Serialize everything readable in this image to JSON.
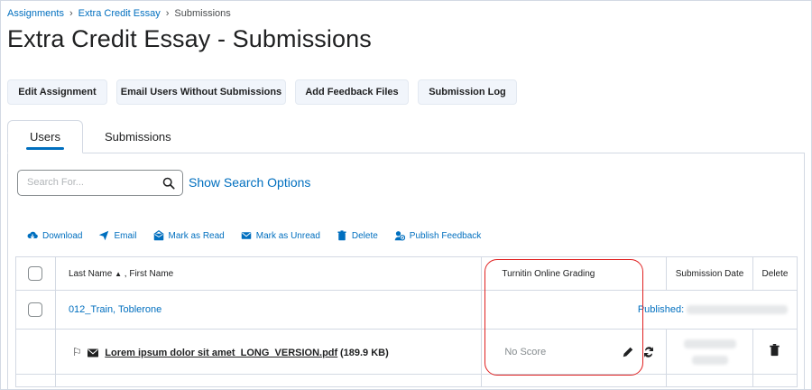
{
  "breadcrumbs": {
    "level1": "Assignments",
    "level2": "Extra Credit Essay",
    "current": "Submissions"
  },
  "page_title": "Extra Credit Essay - Submissions",
  "buttons": {
    "edit_assignment": "Edit Assignment",
    "email_users": "Email Users Without Submissions",
    "add_feedback": "Add Feedback Files",
    "submission_log": "Submission Log"
  },
  "tabs": {
    "users": "Users",
    "submissions": "Submissions"
  },
  "search": {
    "placeholder": "Search For...",
    "options_link": "Show Search Options"
  },
  "actions": {
    "download": "Download",
    "email": "Email",
    "mark_read": "Mark as Read",
    "mark_unread": "Mark as Unread",
    "delete": "Delete",
    "publish": "Publish Feedback"
  },
  "table": {
    "headers": {
      "name": "Last Name",
      "sort_arrow": "▲",
      "name_rest": ", First Name",
      "turnitin": "Turnitin Online Grading",
      "date": "Submission Date",
      "delete": "Delete"
    },
    "rows": [
      {
        "user": "012_Train, Toblerone",
        "status": "Published:",
        "file_name": "Lorem ipsum dolor sit amet_LONG_VERSION.pdf",
        "file_size": "(189.9 KB)",
        "score": "No Score"
      }
    ]
  },
  "colors": {
    "link": "#006fbf",
    "annotation": "#e02020",
    "button_bg": "#f1f5fb"
  }
}
